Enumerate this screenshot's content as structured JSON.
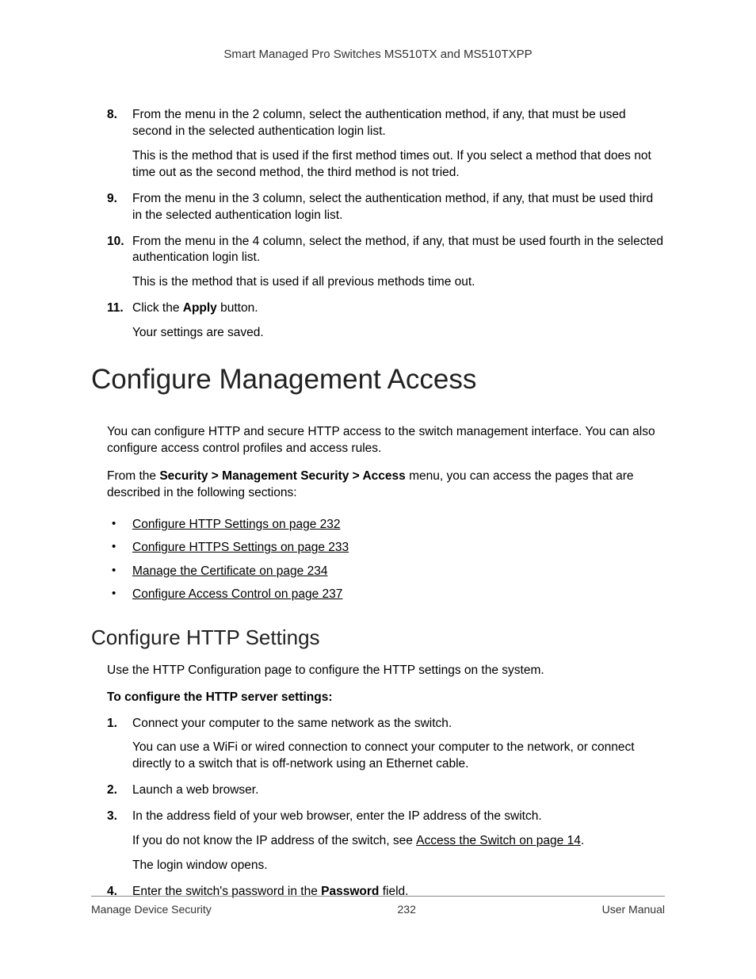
{
  "header": {
    "title": "Smart Managed Pro Switches MS510TX and MS510TXPP"
  },
  "steps_a": [
    {
      "num": "8.",
      "text": "From the menu in the 2 column, select the authentication method, if any, that must be used second in the selected authentication login list.",
      "extra": "This is the method that is used if the first method times out. If you select a method that does not time out as the second method, the third method is not tried."
    },
    {
      "num": "9.",
      "text": "From the menu in the 3 column, select the authentication method, if any, that must be used third in the selected authentication login list."
    },
    {
      "num": "10.",
      "text": "From the menu in the 4 column, select the method, if any, that must be used fourth in the selected authentication login list.",
      "extra": "This is the method that is used if all previous methods time out."
    },
    {
      "num": "11.",
      "pre": "Click the ",
      "bold": "Apply",
      "post": " button.",
      "extra": "Your settings are saved."
    }
  ],
  "h1": "Configure Management Access",
  "intro_para": "You can configure HTTP and secure HTTP access to the switch management interface. You can also configure access control profiles and access rules.",
  "menu_para_pre": "From the ",
  "menu_para_bold": "Security > Management Security > Access",
  "menu_para_post": " menu, you can access the pages that are described in the following sections:",
  "bullets": [
    "Configure HTTP Settings on page 232",
    "Configure HTTPS Settings on page 233",
    "Manage the Certificate on page 234",
    "Configure Access Control on page 237"
  ],
  "h2": "Configure HTTP Settings",
  "h2_para": "Use the HTTP Configuration page to configure the HTTP settings on the system.",
  "sub_heading": "To configure the HTTP server settings:",
  "steps_b": [
    {
      "num": "1.",
      "text": "Connect your computer to the same network as the switch.",
      "extra": "You can use a WiFi or wired connection to connect your computer to the network, or connect directly to a switch that is off-network using an Ethernet cable."
    },
    {
      "num": "2.",
      "text": "Launch a web browser."
    },
    {
      "num": "3.",
      "text": "In the address field of your web browser, enter the IP address of the switch.",
      "extra_pre": "If you do not know the IP address of the switch, see ",
      "extra_link": "Access the Switch on page 14",
      "extra_post": ".",
      "extra2": "The login window opens."
    },
    {
      "num": "4.",
      "pre": "Enter the switch's password in the ",
      "bold": "Password",
      "post": " field."
    }
  ],
  "footer": {
    "left": "Manage Device Security",
    "center": "232",
    "right": "User Manual"
  }
}
